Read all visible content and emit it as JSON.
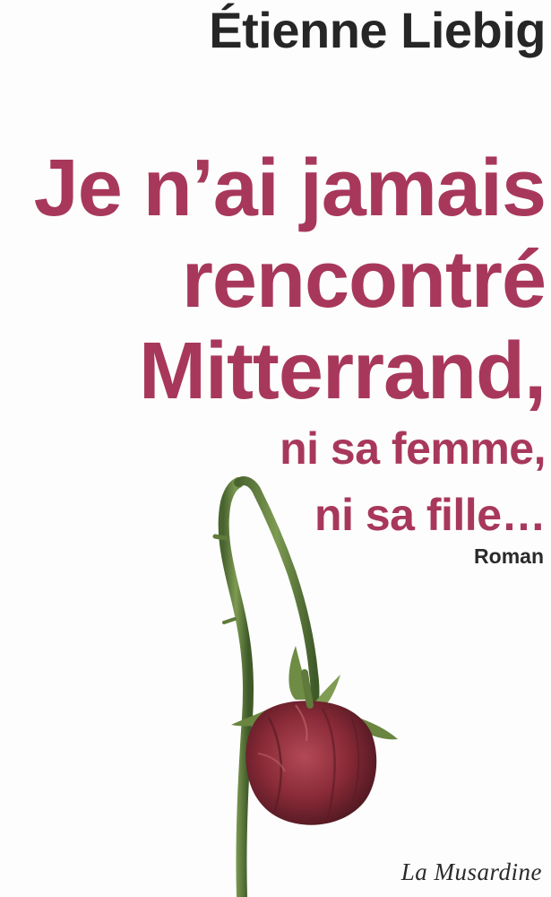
{
  "cover": {
    "author": "Étienne Liebig",
    "title_lines": [
      "Je n’ai jamais",
      "rencontré",
      "Mitterrand,",
      "ni sa femme,",
      "ni sa fille…"
    ],
    "genre": "Roman",
    "publisher": "La Musardine",
    "colors": {
      "title": "#a8385b",
      "author": "#262626",
      "rose_petal": "#8a2a38",
      "stem": "#5f7a3a"
    },
    "illustration": "wilted-rose-icon"
  }
}
